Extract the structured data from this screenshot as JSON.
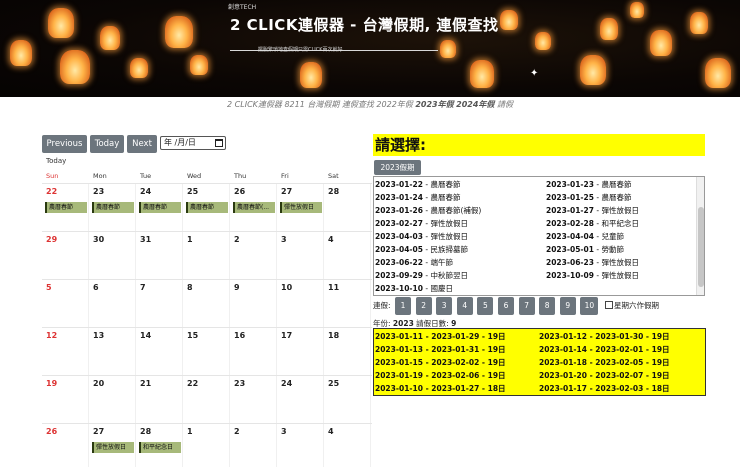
{
  "banner": {
    "brand": "創意TECH",
    "title": "2 CLICK連假器 - 台灣假期, 連假查找",
    "subtitle": "擺脫繁瑣地查假期只需CLICK兩次就好"
  },
  "caption": {
    "prefix": "2 CLICK連假器 8211 台灣假期 連假查找 2022年假 ",
    "bold1": "2023年假",
    "mid": " ",
    "bold2": "2024年假",
    "suffix": " 請假"
  },
  "calendar": {
    "prev_label": "Previous",
    "today_label": "Today",
    "next_label": "Next",
    "date_placeholder": "年 /月/日",
    "today_text": "Today",
    "weekdays": [
      "Sun",
      "Mon",
      "Tue",
      "Wed",
      "Thu",
      "Fri",
      "Sat"
    ],
    "weeks": [
      [
        {
          "d": "22",
          "ev": "農曆春節"
        },
        {
          "d": "23",
          "ev": "農曆春節"
        },
        {
          "d": "24",
          "ev": "農曆春節"
        },
        {
          "d": "25",
          "ev": "農曆春節"
        },
        {
          "d": "26",
          "ev": "農曆春節(..."
        },
        {
          "d": "27",
          "ev": "彈性放假日"
        },
        {
          "d": "28",
          "ev": ""
        }
      ],
      [
        {
          "d": "29",
          "ev": ""
        },
        {
          "d": "30",
          "ev": ""
        },
        {
          "d": "31",
          "ev": ""
        },
        {
          "d": "1",
          "ev": ""
        },
        {
          "d": "2",
          "ev": ""
        },
        {
          "d": "3",
          "ev": ""
        },
        {
          "d": "4",
          "ev": ""
        }
      ],
      [
        {
          "d": "5",
          "ev": ""
        },
        {
          "d": "6",
          "ev": ""
        },
        {
          "d": "7",
          "ev": ""
        },
        {
          "d": "8",
          "ev": ""
        },
        {
          "d": "9",
          "ev": ""
        },
        {
          "d": "10",
          "ev": ""
        },
        {
          "d": "11",
          "ev": ""
        }
      ],
      [
        {
          "d": "12",
          "ev": ""
        },
        {
          "d": "13",
          "ev": ""
        },
        {
          "d": "14",
          "ev": ""
        },
        {
          "d": "15",
          "ev": ""
        },
        {
          "d": "16",
          "ev": ""
        },
        {
          "d": "17",
          "ev": ""
        },
        {
          "d": "18",
          "ev": ""
        }
      ],
      [
        {
          "d": "19",
          "ev": ""
        },
        {
          "d": "20",
          "ev": ""
        },
        {
          "d": "21",
          "ev": ""
        },
        {
          "d": "22",
          "ev": ""
        },
        {
          "d": "23",
          "ev": ""
        },
        {
          "d": "24",
          "ev": ""
        },
        {
          "d": "25",
          "ev": ""
        }
      ],
      [
        {
          "d": "26",
          "ev": ""
        },
        {
          "d": "27",
          "ev": "彈性放假日"
        },
        {
          "d": "28",
          "ev": "和平紀念日"
        },
        {
          "d": "1",
          "ev": ""
        },
        {
          "d": "2",
          "ev": ""
        },
        {
          "d": "3",
          "ev": ""
        },
        {
          "d": "4",
          "ev": ""
        }
      ]
    ]
  },
  "panel": {
    "title": "請選擇:",
    "tab_label": "2023假期",
    "holidays_left": [
      {
        "date": "2023-01-22",
        "name": "農曆春節"
      },
      {
        "date": "2023-01-24",
        "name": "農曆春節"
      },
      {
        "date": "2023-01-26",
        "name": "農曆春節(補假)"
      },
      {
        "date": "2023-02-27",
        "name": "彈性放假日"
      },
      {
        "date": "2023-04-03",
        "name": "彈性放假日"
      },
      {
        "date": "2023-04-05",
        "name": "民族掃墓節"
      },
      {
        "date": "2023-06-22",
        "name": "端午節"
      },
      {
        "date": "2023-09-29",
        "name": "中秋節翌日"
      },
      {
        "date": "2023-10-10",
        "name": "國慶日"
      }
    ],
    "holidays_right": [
      {
        "date": "2023-01-23",
        "name": "農曆春節"
      },
      {
        "date": "2023-01-25",
        "name": "農曆春節"
      },
      {
        "date": "2023-01-27",
        "name": "彈性放假日"
      },
      {
        "date": "2023-02-28",
        "name": "和平紀念日"
      },
      {
        "date": "2023-04-04",
        "name": "兒童節"
      },
      {
        "date": "2023-05-01",
        "name": "勞動節"
      },
      {
        "date": "2023-06-23",
        "name": "彈性放假日"
      },
      {
        "date": "2023-10-09",
        "name": "彈性放假日"
      }
    ],
    "separator": " - ",
    "lian_label": "連假:",
    "num_buttons": [
      "1",
      "2",
      "3",
      "4",
      "5",
      "6",
      "7",
      "8",
      "9",
      "10"
    ],
    "checkbox_label": "星期六作假期",
    "year_prefix": "年份: ",
    "year_value": "2023",
    "leave_prefix": "  請假日數: ",
    "leave_value": "9",
    "results_left": [
      "2023-01-11 - 2023-01-29 - 19日",
      "2023-01-13 - 2023-01-31 - 19日",
      "2023-01-15 - 2023-02-02 - 19日",
      "2023-01-19 - 2023-02-06 - 19日",
      "2023-01-10 - 2023-01-27 - 18日"
    ],
    "results_right": [
      "2023-01-12 - 2023-01-30 - 19日",
      "2023-01-14 - 2023-02-01 - 19日",
      "2023-01-18 - 2023-02-05 - 19日",
      "2023-01-20 - 2023-02-07 - 19日",
      "2023-01-17 - 2023-02-03 - 18日"
    ]
  }
}
